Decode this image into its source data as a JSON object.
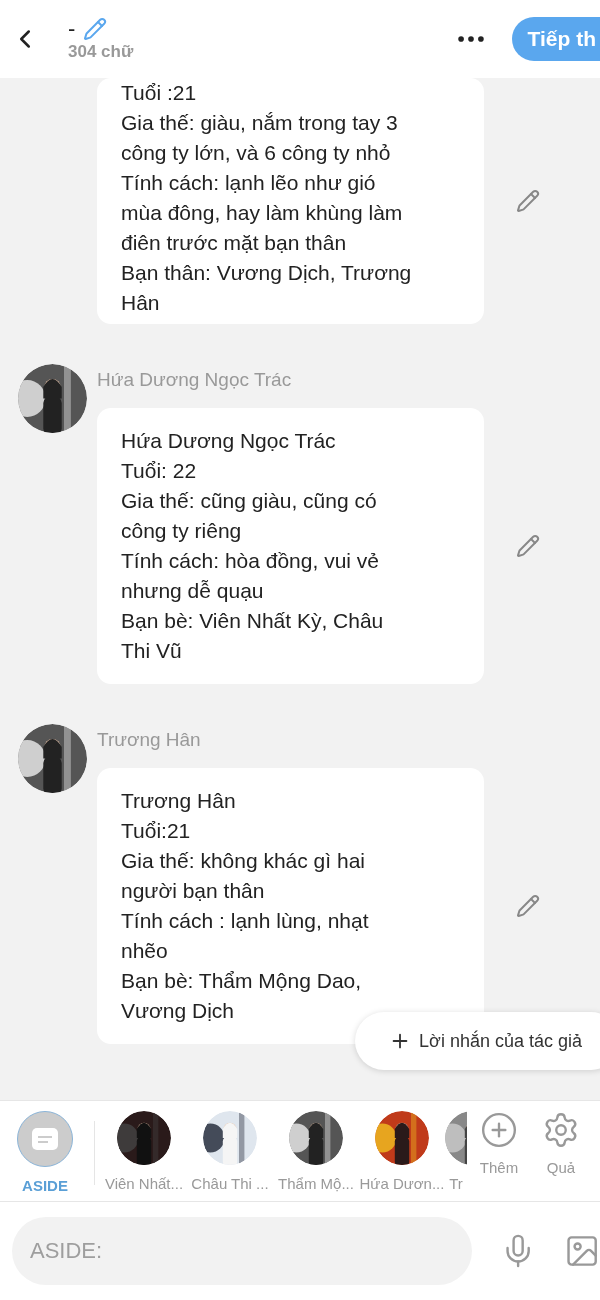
{
  "header": {
    "title": "-",
    "word_count": "304 chữ",
    "next_button": "Tiếp th"
  },
  "messages": [
    {
      "text": "Tuổi :21\nGia thế: giàu, nắm trong tay 3\ncông ty lớn, và 6 công ty nhỏ\nTính cách: lạnh lẽo như gió\nmùa đông, hay làm khùng làm\nđiên trước mặt bạn thân\nBạn thân: Vương Dịch, Trương\nHân"
    },
    {
      "sender": "Hứa Dương Ngọc Trác",
      "text": "Hứa Dương Ngọc Trác\nTuổi: 22\nGia thế: cũng giàu, cũng có\ncông ty riêng\nTính cách: hòa đồng, vui vẻ\nnhưng dễ quạu\nBạn bè: Viên Nhất Kỳ, Châu\nThi Vũ"
    },
    {
      "sender": "Trương Hân",
      "text": "Trương Hân\nTuổi:21\nGia thế: không khác gì hai\nngười bạn thân\nTính cách : lạnh lùng, nhạt\nnhẽo\nBạn bè: Thẩm Mộng Dao,\nVương Dịch"
    }
  ],
  "author_note_button": "Lời nhắn của tác giả",
  "characters": [
    {
      "kind": "aside",
      "label": "ASIDE",
      "selected": true
    },
    {
      "kind": "avatar",
      "label": "Viên Nhất...",
      "selected": false
    },
    {
      "kind": "avatar",
      "label": "Châu Thi ...",
      "selected": false
    },
    {
      "kind": "avatar",
      "label": "Thẩm Mộ...",
      "selected": false
    },
    {
      "kind": "avatar",
      "label": "Hứa Dươn...",
      "selected": false
    },
    {
      "kind": "avatar",
      "label": "Tr",
      "selected": false
    }
  ],
  "actions": [
    {
      "kind": "add",
      "label": "Thêm"
    },
    {
      "kind": "settings",
      "label": "Quả"
    }
  ],
  "input": {
    "placeholder": "ASIDE:"
  }
}
